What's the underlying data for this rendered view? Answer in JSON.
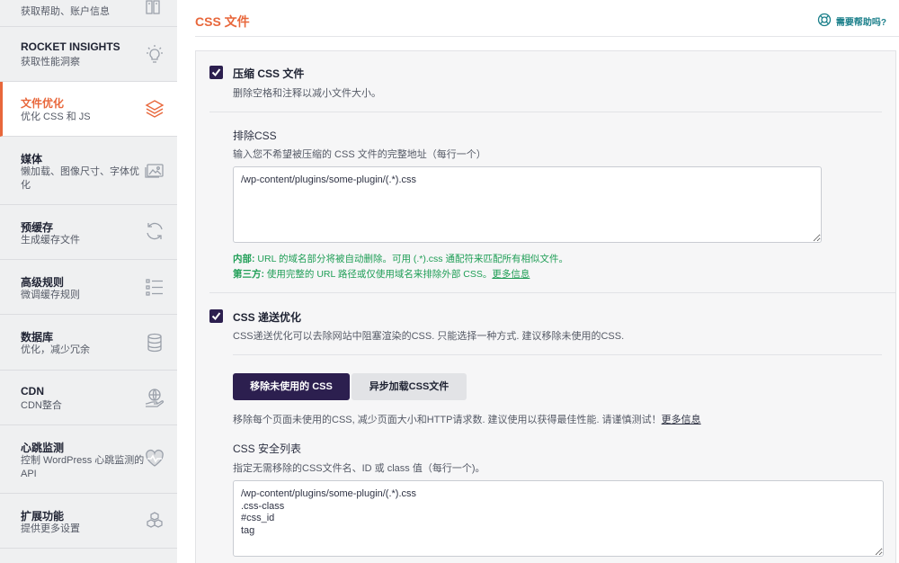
{
  "sidebar": {
    "items": [
      {
        "title": "",
        "subtitle": "获取帮助、账户信息",
        "icon": "book-icon"
      },
      {
        "title": "ROCKET INSIGHTS",
        "subtitle": "获取性能洞察",
        "icon": "lightbulb-icon"
      },
      {
        "title": "文件优化",
        "subtitle": "优化 CSS 和 JS",
        "icon": "layers-icon",
        "active": true
      },
      {
        "title": "媒体",
        "subtitle": "懒加载、图像尺寸、字体优化",
        "icon": "image-icon"
      },
      {
        "title": "预缓存",
        "subtitle": "生成缓存文件",
        "icon": "refresh-icon"
      },
      {
        "title": "高级规则",
        "subtitle": "微调缓存规则",
        "icon": "list-icon"
      },
      {
        "title": "数据库",
        "subtitle": "优化，减少冗余",
        "icon": "database-icon"
      },
      {
        "title": "CDN",
        "subtitle": "CDN整合",
        "icon": "globe-hand-icon"
      },
      {
        "title": "心跳监测",
        "subtitle": "控制 WordPress 心跳监测的 API",
        "icon": "heartbeat-icon"
      },
      {
        "title": "扩展功能",
        "subtitle": "提供更多设置",
        "icon": "cubes-icon"
      }
    ]
  },
  "header": {
    "title": "CSS 文件",
    "help_label": "需要帮助吗?",
    "help_icon": "lifebuoy-icon"
  },
  "minify": {
    "checked": true,
    "title": "压缩 CSS 文件",
    "description": "删除空格和注释以减小文件大小。",
    "exclude": {
      "label": "排除CSS",
      "description": "输入您不希望被压缩的 CSS 文件的完整地址（每行一个）",
      "value": "/wp-content/plugins/some-plugin/(.*).css",
      "note1_strong": "内部:",
      "note1_text": " URL 的域名部分将被自动删除。可用 (.*).css 通配符来匹配所有相似文件。",
      "note2_strong": "第三方:",
      "note2_text": " 使用完整的 URL 路径或仅使用域名来排除外部 CSS。",
      "note2_link": "更多信息"
    }
  },
  "delivery": {
    "checked": true,
    "title": "CSS 递送优化",
    "description": "CSS递送优化可以去除网站中阻塞渲染的CSS. 只能选择一种方式. 建议移除未使用的CSS.",
    "buttons": {
      "remove_unused": "移除未使用的 CSS",
      "async_load": "异步加载CSS文件"
    },
    "remove_desc": "移除每个页面未使用的CSS, 减少页面大小和HTTP请求数. 建议使用以获得最佳性能. 请谨慎测试！",
    "remove_desc_link": "更多信息",
    "safelist": {
      "label": "CSS 安全列表",
      "description": "指定无需移除的CSS文件名、ID 或 class 值（每行一个)。",
      "value": "/wp-content/plugins/some-plugin/(.*).css\n.css-class\n#css_id\ntag"
    }
  },
  "colors": {
    "accent": "#e8673b",
    "primary_button": "#2c1f4f",
    "success_note": "#1f9e56",
    "help_link": "#1a7f8a"
  }
}
